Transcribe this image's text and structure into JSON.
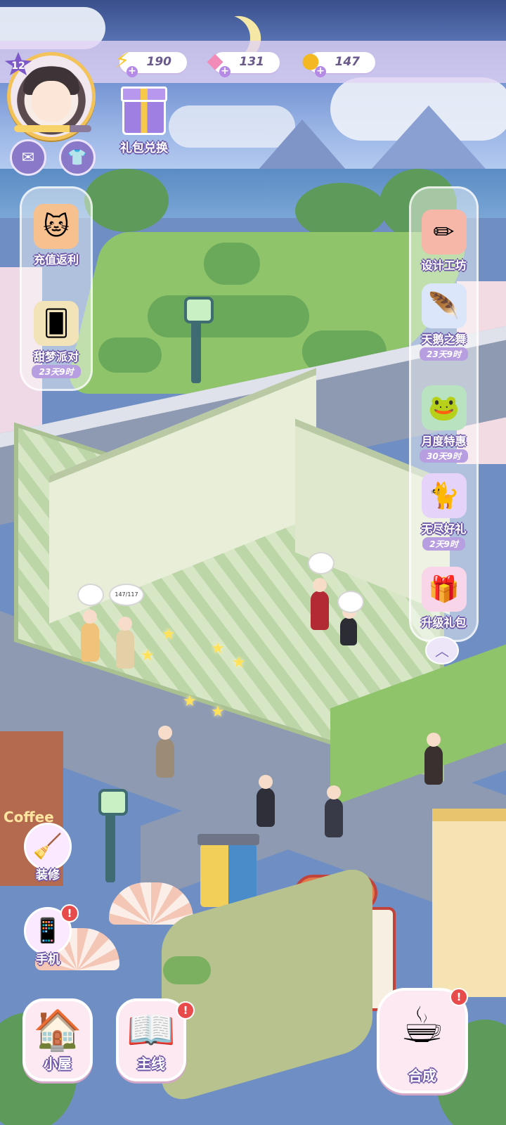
{
  "player": {
    "level": "12",
    "exp_fraction": 0.72
  },
  "resources": [
    {
      "name": "energy",
      "icon": "lightning-icon",
      "value": "190",
      "color": "#f7c733"
    },
    {
      "name": "gems",
      "icon": "gem-icon",
      "value": "131",
      "color": "#f28bb8"
    },
    {
      "name": "coins",
      "icon": "coin-icon",
      "value": "147",
      "color": "#f4b822"
    }
  ],
  "top_buttons": {
    "mail_icon": "mail-icon",
    "wardrobe_icon": "shirt-icon",
    "gift_exchange_label": "礼包兑换"
  },
  "left_panel": [
    {
      "name": "充值返利",
      "icon": "witch-cat-icon",
      "timer": ""
    },
    {
      "name": "甜梦派对",
      "icon": "cards-icon",
      "timer": "23天9时"
    }
  ],
  "right_panel": [
    {
      "name": "设计工坊",
      "icon": "ruler-pencil-icon",
      "timer": ""
    },
    {
      "name": "天鹅之舞",
      "icon": "feather-icon",
      "timer": "23天9时"
    },
    {
      "name": "月度特惠",
      "icon": "frog-icon",
      "timer": "30天9时"
    },
    {
      "name": "无尽好礼",
      "icon": "cat-gift-icon",
      "timer": "2天9时"
    },
    {
      "name": "升级礼包",
      "icon": "gift-box-icon",
      "timer": ""
    }
  ],
  "side_buttons": [
    {
      "name": "装修",
      "icon": "broom-icon",
      "alert": false
    },
    {
      "name": "手机",
      "icon": "phone-icon",
      "alert": true
    }
  ],
  "bottom_buttons": [
    {
      "name": "小屋",
      "icon": "house-icon",
      "alert": false
    },
    {
      "name": "主线",
      "icon": "book-icon",
      "alert": true
    },
    {
      "name": "合成",
      "icon": "teacup-icon",
      "alert": true
    }
  ],
  "scene": {
    "coffee_sign": "Coffee",
    "speech_counter": "147/117"
  },
  "colors": {
    "hud_bar": "#e2d4f5",
    "label_outline": "#6e56a8",
    "alert": "#e84b4b",
    "timer_bg": "#b79ee0"
  }
}
